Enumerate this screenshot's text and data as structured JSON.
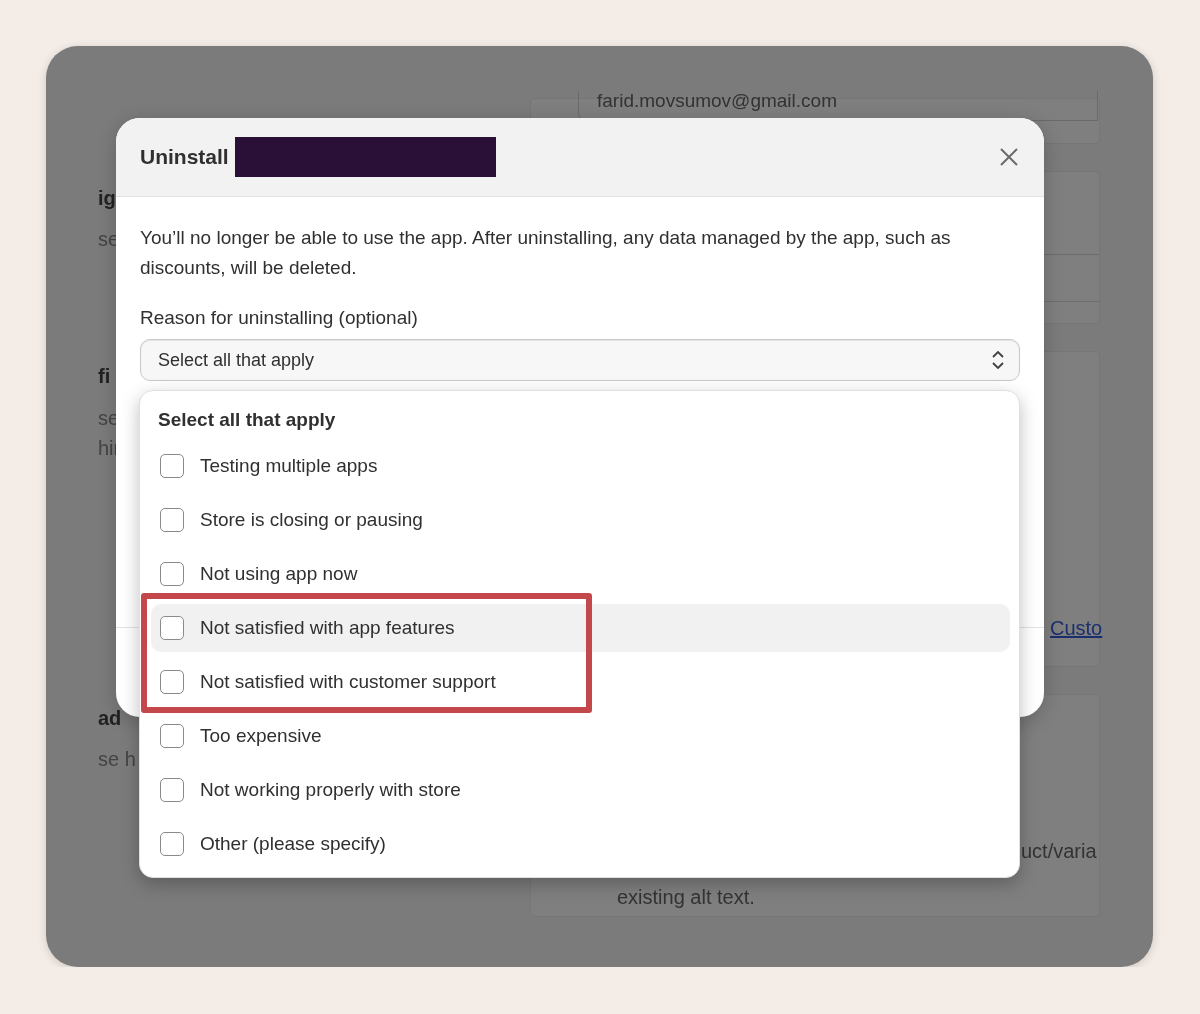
{
  "background": {
    "left_fragments": [
      {
        "text": "ig",
        "kind": "heading"
      },
      {
        "text": "se",
        "kind": "body"
      },
      {
        "text": "fi",
        "kind": "heading"
      },
      {
        "text": "se",
        "kind": "body"
      },
      {
        "text": "hir",
        "kind": "body"
      },
      {
        "text": "ad",
        "kind": "heading"
      },
      {
        "text": "se h",
        "kind": "body"
      }
    ],
    "email": "farid.movsumov@gmail.com",
    "link": "Custo",
    "fragments": [
      "uct/varia",
      "existing alt text."
    ]
  },
  "modal": {
    "title": "Uninstall",
    "title_redacted": true,
    "description": "You’ll no longer be able to use the app. After uninstalling, any data managed by the app, such as discounts, will be deleted.",
    "field_label": "Reason for uninstalling (optional)",
    "select": {
      "placeholder": "Select all that apply"
    }
  },
  "dropdown": {
    "heading": "Select all that apply",
    "options": [
      {
        "label": "Testing multiple apps",
        "checked": false,
        "highlighted": false,
        "annotated": false
      },
      {
        "label": "Store is closing or pausing",
        "checked": false,
        "highlighted": false,
        "annotated": false
      },
      {
        "label": "Not using app now",
        "checked": false,
        "highlighted": false,
        "annotated": false
      },
      {
        "label": "Not satisfied with app features",
        "checked": false,
        "highlighted": true,
        "annotated": true
      },
      {
        "label": "Not satisfied with customer support",
        "checked": false,
        "highlighted": false,
        "annotated": true
      },
      {
        "label": "Too expensive",
        "checked": false,
        "highlighted": false,
        "annotated": false
      },
      {
        "label": "Not working properly with store",
        "checked": false,
        "highlighted": false,
        "annotated": false
      },
      {
        "label": "Other (please specify)",
        "checked": false,
        "highlighted": false,
        "annotated": false
      }
    ]
  }
}
